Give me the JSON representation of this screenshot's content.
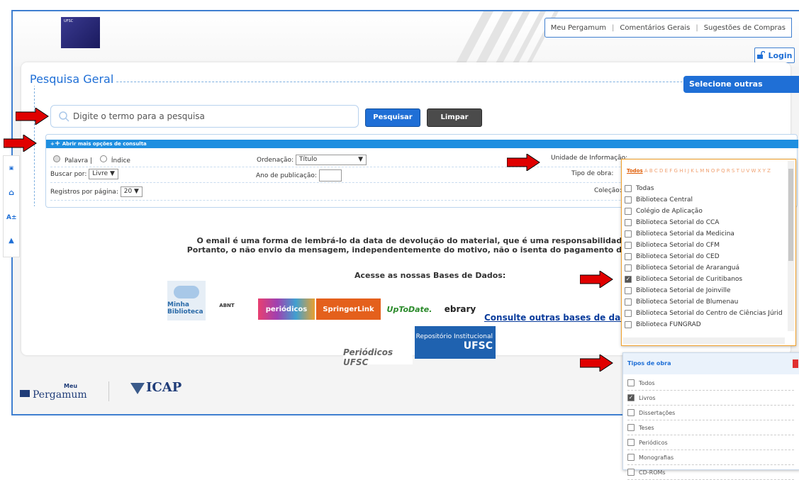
{
  "header": {
    "logo_text": "UFSC",
    "nav": [
      "Meu Pergamum",
      "Comentários Gerais",
      "Sugestões de Compras"
    ],
    "login": "Login"
  },
  "search": {
    "title": "Pesquisa Geral",
    "other_searches": "Selecione outras pesquisas",
    "placeholder": "Digite o termo para a pesquisa",
    "submit": "Pesquisar",
    "clear": "Limpar"
  },
  "options": {
    "bar_label": "Abrir mais opções de consulta",
    "radio_palavra": "Palavra |",
    "radio_indice": "Índice",
    "buscar_por_label": "Buscar por:",
    "buscar_por_value": "Livre",
    "registros_label": "Registros por página:",
    "registros_value": "20",
    "ordenacao_label": "Ordenação:",
    "ordenacao_value": "Título",
    "ano_label": "Ano de publicação:",
    "unidade_label": "Unidade de Informação:",
    "tipo_obra_label": "Tipo de obra:",
    "colecao_label": "Coleção:"
  },
  "sidebar": {
    "icons": [
      "meu-pergamum-icon",
      "home-icon",
      "font-size-icon",
      "up-icon"
    ],
    "font_glyph": "A±"
  },
  "message": {
    "line1": "O email é uma forma de lembrá-lo da data de devolução do material, que é uma responsabilidade sua.",
    "line2": "Portanto, o não envio da mensagem, independentemente do motivo, não o isenta do pagamento de multa."
  },
  "databases": {
    "title": "Acesse as nossas Bases de Dados:",
    "logos": [
      "Minha Biblioteca",
      "ABNT",
      "periódicos",
      "SpringerLink",
      "UpToDate.",
      "ebrary"
    ],
    "more_link": "Consulte outras bases de dados de a",
    "repositorio": [
      "Repositório Institucional",
      "UFSC"
    ],
    "periodicos_ufsc": "Periódicos UFSC"
  },
  "footer": {
    "pergamum": "Pergamum",
    "pergamum_top": "Meu",
    "icap": "ICAP"
  },
  "unidade_dropdown": {
    "alphabet_prefix": "Todos",
    "alphabet": "A B C D E F G H I J K L M N O P Q R S T U V W X Y Z",
    "items": [
      {
        "label": "Todas",
        "checked": false
      },
      {
        "label": "Biblioteca Central",
        "checked": false
      },
      {
        "label": "Colégio de Aplicação",
        "checked": false
      },
      {
        "label": "Biblioteca Setorial do CCA",
        "checked": false
      },
      {
        "label": "Biblioteca Setorial da Medicina",
        "checked": false
      },
      {
        "label": "Biblioteca Setorial do CFM",
        "checked": false
      },
      {
        "label": "Biblioteca Setorial do CED",
        "checked": false
      },
      {
        "label": "Biblioteca Setorial de Araranguá",
        "checked": false
      },
      {
        "label": "Biblioteca Setorial de Curitibanos",
        "checked": true
      },
      {
        "label": "Biblioteca Setorial de Joinville",
        "checked": false
      },
      {
        "label": "Biblioteca Setorial de Blumenau",
        "checked": false
      },
      {
        "label": "Biblioteca Setorial do Centro de Ciências Júrid",
        "checked": false
      },
      {
        "label": "Biblioteca FUNGRAD",
        "checked": false
      }
    ]
  },
  "tipos_dropdown": {
    "title": "Tipos de obra",
    "items": [
      {
        "label": "Todos",
        "checked": false
      },
      {
        "label": "Livros",
        "checked": true
      },
      {
        "label": "Dissertações",
        "checked": false
      },
      {
        "label": "Teses",
        "checked": false
      },
      {
        "label": "Periódicos",
        "checked": false
      },
      {
        "label": "Monografias",
        "checked": false
      },
      {
        "label": "CD-ROMs",
        "checked": false
      }
    ]
  },
  "colors": {
    "accent": "#1f6fd6",
    "arrow": "#e00000",
    "dropdown_border": "#f0a02a"
  }
}
